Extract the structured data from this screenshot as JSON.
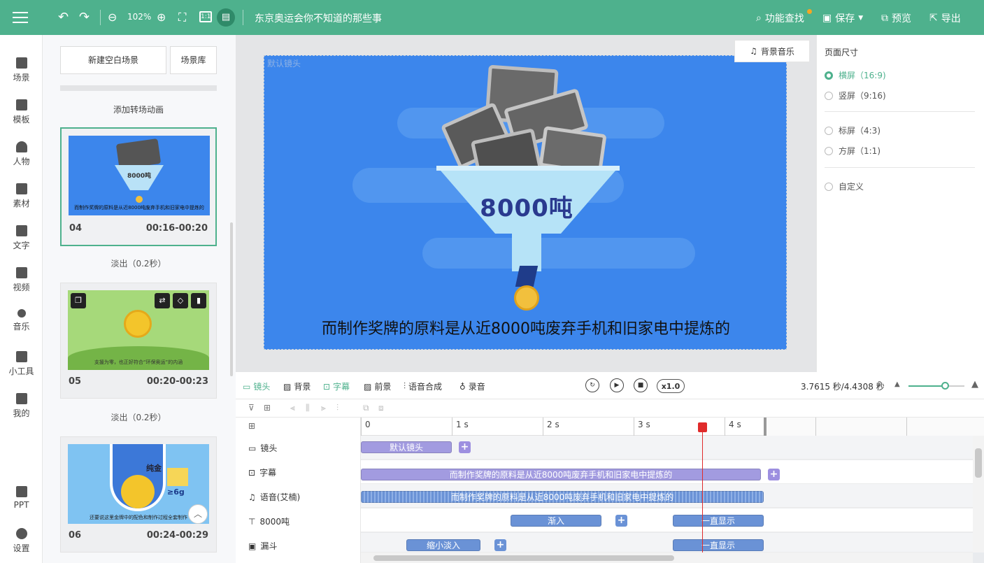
{
  "header": {
    "zoom": "102%",
    "project_title": "东京奥运会你不知道的那些事",
    "actions": [
      {
        "label": "功能查找",
        "icon": "search-icon"
      },
      {
        "label": "保存",
        "icon": "save-icon"
      },
      {
        "label": "预览",
        "icon": "preview-icon"
      },
      {
        "label": "导出",
        "icon": "export-icon"
      }
    ]
  },
  "leftnav": [
    {
      "label": "场景",
      "icon": "scene-icon"
    },
    {
      "label": "模板",
      "icon": "template-icon"
    },
    {
      "label": "人物",
      "icon": "person-icon"
    },
    {
      "label": "素材",
      "icon": "material-icon"
    },
    {
      "label": "文字",
      "icon": "text-icon"
    },
    {
      "label": "视频",
      "icon": "video-icon"
    },
    {
      "label": "音乐",
      "icon": "music-icon"
    },
    {
      "label": "小工具",
      "icon": "toolbox-icon"
    },
    {
      "label": "我的",
      "icon": "upload-icon"
    },
    {
      "label": "PPT",
      "icon": "ppt-icon"
    },
    {
      "label": "设置",
      "icon": "gear-icon"
    }
  ],
  "scenes_panel": {
    "new_scene": "新建空白场景",
    "library": "场景库",
    "add_transition": "添加转场动画",
    "scenes": [
      {
        "no": "04",
        "time": "00:16-00:20",
        "caption": "而制作奖牌的原料是从近8000吨废弃手机和旧家电中提炼的",
        "thumb_text": "8000吨"
      },
      {
        "no": "05",
        "time": "00:20-00:23",
        "caption": "支援为零，也正好符合“环保奥运”的内涵"
      },
      {
        "no": "06",
        "time": "00:24-00:29",
        "caption": "还要说这里金牌中的配色和制作过程全套制作",
        "badge": "纯金",
        "amount": "≥6g"
      }
    ],
    "transitions": [
      "淡出（0.2秒）",
      "淡出（0.2秒）"
    ]
  },
  "stage": {
    "camera_label": "默认镜头",
    "big_text": "8000吨",
    "subtitle": "而制作奖牌的原料是从近8000吨废弃手机和旧家电中提炼的",
    "bgm_button": "背景音乐"
  },
  "right_panel": {
    "title": "页面尺寸",
    "options": [
      {
        "label": "横屏（16:9)",
        "selected": true
      },
      {
        "label": "竖屏（9:16)",
        "selected": false
      },
      {
        "label": "标屏（4:3)",
        "selected": false
      },
      {
        "label": "方屏（1:1)",
        "selected": false
      },
      {
        "label": "自定义",
        "selected": false
      }
    ]
  },
  "timeline": {
    "tabs": [
      "镜头",
      "背景",
      "字幕",
      "前景",
      "语音合成",
      "录音"
    ],
    "active_tab": "字幕",
    "speed": "x1.0",
    "time_display": "3.7615 秒/4.4308 秒",
    "ruler": [
      "0",
      "1 s",
      "2 s",
      "3 s",
      "4 s"
    ],
    "tracks": [
      {
        "name": "镜头",
        "icon": "camera-icon",
        "clips": [
          "默认镜头"
        ]
      },
      {
        "name": "字幕",
        "icon": "subtitle-icon",
        "clips": [
          "而制作奖牌的原料是从近8000吨废弃手机和旧家电中提炼的"
        ]
      },
      {
        "name": "语音(艾楠)",
        "icon": "music-note-icon",
        "clips": [
          "而制作奖牌的原料是从近8000吨废弃手机和旧家电中提炼的"
        ]
      },
      {
        "name": "8000吨",
        "icon": "text-box-icon",
        "clips": [
          "渐入",
          "一直显示"
        ]
      },
      {
        "name": "漏斗",
        "icon": "image-icon",
        "clips": [
          "缩小淡入",
          "一直显示"
        ]
      }
    ]
  },
  "colors": {
    "brand": "#4eb18d",
    "stage_bg": "#3c86ec",
    "clip_purple": "#a29be0",
    "playhead": "#e02b2b"
  }
}
